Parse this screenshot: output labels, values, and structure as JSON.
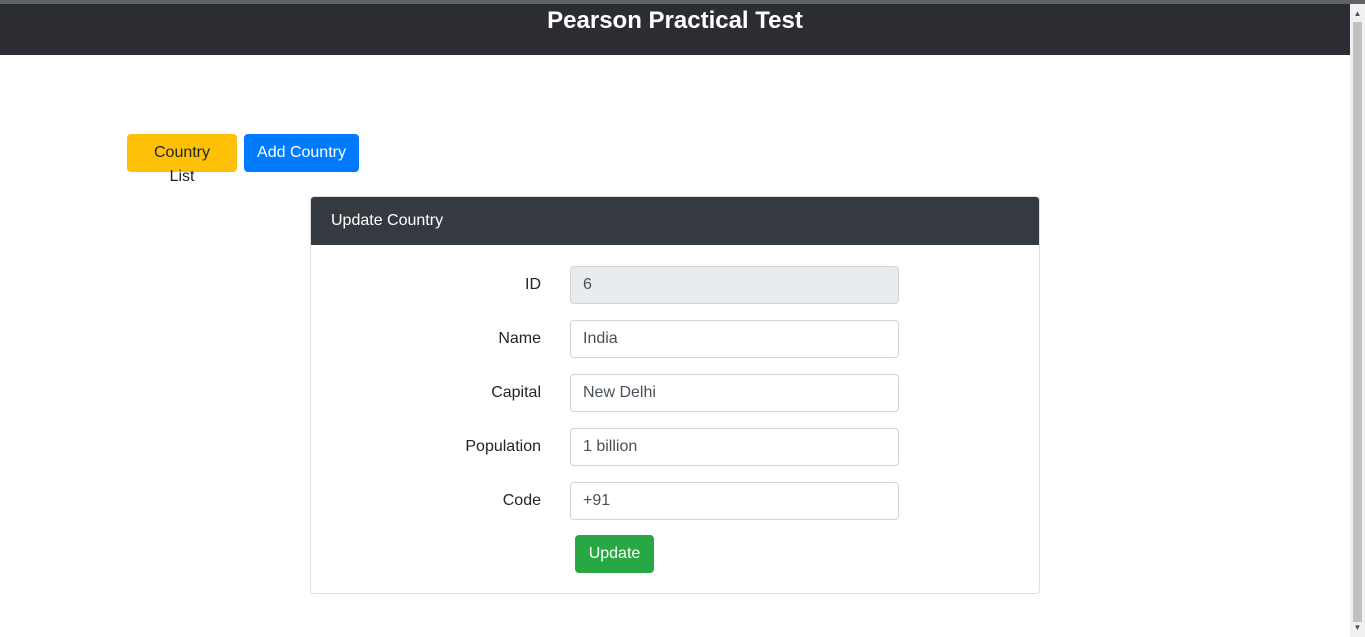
{
  "header": {
    "title": "Pearson Practical Test"
  },
  "nav": {
    "country_list_label": "Country List",
    "add_country_label": "Add Country"
  },
  "card": {
    "title": "Update Country",
    "fields": [
      {
        "label": "ID",
        "value": "6",
        "readonly": true
      },
      {
        "label": "Name",
        "value": "India",
        "readonly": false
      },
      {
        "label": "Capital",
        "value": "New Delhi",
        "readonly": false
      },
      {
        "label": "Population",
        "value": "1 billion",
        "readonly": false
      },
      {
        "label": "Code",
        "value": "+91",
        "readonly": false
      }
    ],
    "submit_label": "Update"
  },
  "colors": {
    "header_bg": "#2b2d33",
    "card_header_bg": "#343a40",
    "warning": "#ffc107",
    "primary": "#007bff",
    "success": "#28a745"
  }
}
